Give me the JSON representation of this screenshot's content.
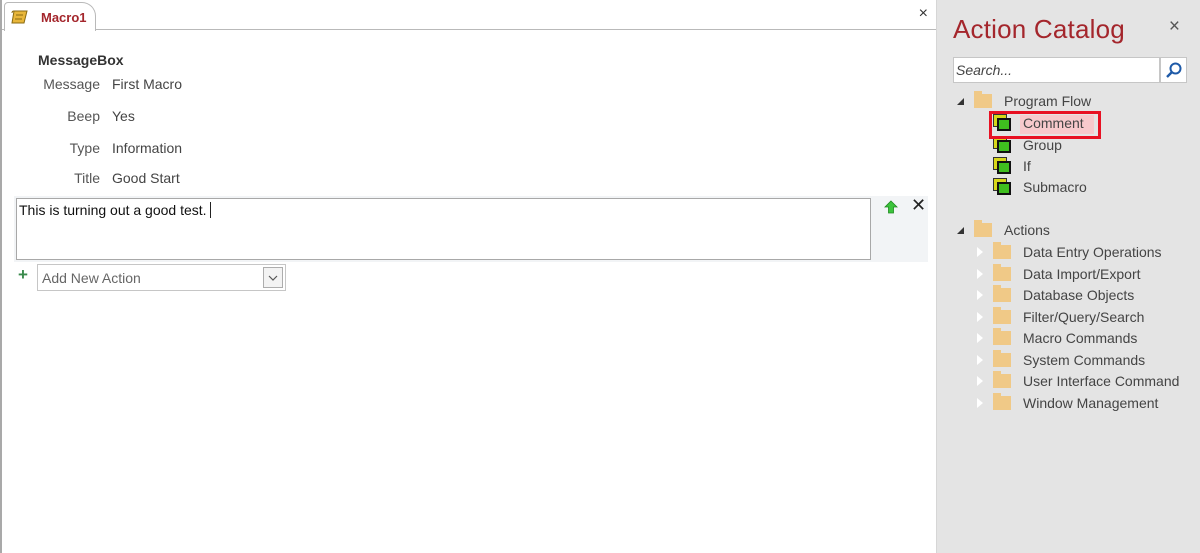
{
  "document": {
    "tab_label": "Macro1",
    "tab_icon": "macro-scroll-icon",
    "close_label": "×",
    "action": {
      "name": "MessageBox",
      "arguments": [
        {
          "label": "Message",
          "value": "First Macro"
        },
        {
          "label": "Beep",
          "value": "Yes"
        },
        {
          "label": "Type",
          "value": "Information"
        },
        {
          "label": "Title",
          "value": "Good Start"
        }
      ]
    },
    "comment_text": "This is turning out a good test.",
    "delete_label": "✕",
    "add_plus": "+",
    "add_action_placeholder": "Add New Action"
  },
  "catalog": {
    "title": "Action Catalog",
    "close_label": "×",
    "search_placeholder": "Search...",
    "program_flow": {
      "label": "Program Flow",
      "items": [
        "Comment",
        "Group",
        "If",
        "Submacro"
      ],
      "highlighted": "Comment"
    },
    "actions": {
      "label": "Actions",
      "items": [
        "Data Entry Operations",
        "Data Import/Export",
        "Database Objects",
        "Filter/Query/Search",
        "Macro Commands",
        "System Commands",
        "User Interface Command",
        "Window Management"
      ]
    }
  },
  "colors": {
    "accent": "#a4262c",
    "highlight_border": "#e81123",
    "pane_background": "#e4e4e4"
  }
}
